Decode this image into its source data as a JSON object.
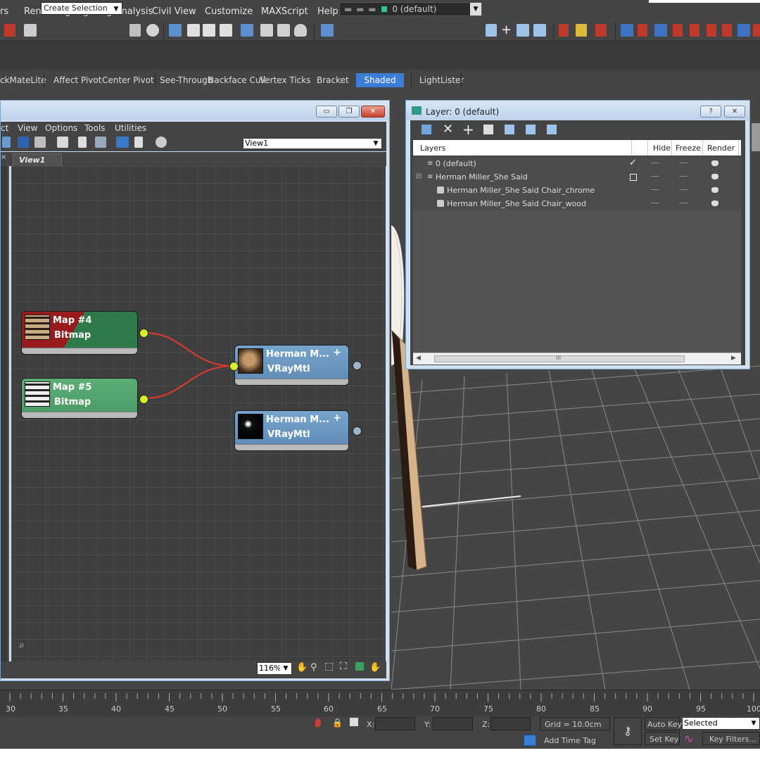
{
  "menu": {
    "items": [
      "rs",
      "Rendering",
      "Lighting Analysis",
      "Civil View",
      "Customize",
      "MAXScript",
      "Help"
    ]
  },
  "toolbar": {
    "selection_set_placeholder": "Create Selection Se",
    "layer_combo": "0 (default)"
  },
  "ribbon": {
    "items": [
      "ckMateLite",
      "Affect Pivot",
      "Center Pivot",
      "See-Through",
      "Backface Cull",
      "Vertex Ticks",
      "Bracket"
    ],
    "shaded": "Shaded",
    "lightlister": "LightLister"
  },
  "slate": {
    "window_buttons": [
      "▭",
      "❐",
      "✕"
    ],
    "menu": [
      "ct",
      "View",
      "Options",
      "Tools",
      "Utilities"
    ],
    "view_combo": "View1",
    "tab": "View1",
    "zoom": "116%",
    "nodes": [
      {
        "title": "Map #4",
        "subtitle": "Bitmap"
      },
      {
        "title": "Map #5",
        "subtitle": "Bitmap"
      },
      {
        "title": "Herman  M...",
        "subtitle": "VRayMtl"
      },
      {
        "title": "Herman  M...",
        "subtitle": "VRayMtl"
      }
    ],
    "plus": "+"
  },
  "layer_dialog": {
    "title": "Layer: 0 (default)",
    "help_button": "?",
    "close_button": "✕",
    "columns": {
      "layers": "Layers",
      "hide": "Hide",
      "freeze": "Freeze",
      "render": "Render"
    },
    "rows": [
      {
        "name": "0 (default)",
        "check": "✓"
      },
      {
        "name": "Herman Miller_She Said",
        "check": ""
      },
      {
        "name": "Herman Miller_She Said Chair_chrome",
        "check": ""
      },
      {
        "name": "Herman Miller_She Said Chair_wood",
        "check": ""
      }
    ],
    "scroll_thumb": "III"
  },
  "timeline": {
    "ticks": [
      "30",
      "35",
      "40",
      "45",
      "50",
      "55",
      "60",
      "65",
      "70",
      "75",
      "80",
      "85",
      "90",
      "95",
      "100"
    ]
  },
  "status": {
    "x_label": "X:",
    "y_label": "Y:",
    "z_label": "Z:",
    "grid": "Grid = 10.0cm",
    "auto_key": "Auto Key",
    "selected": "Selected",
    "set_key": "Set Key",
    "key_filters": "Key Filters...",
    "add_time_tag": "Add Time Tag"
  },
  "colors": {
    "accent": "#3b7ed8",
    "node_bitmap_dark": "#2f7a4a",
    "node_bitmap_light": "#5aad76",
    "node_red": "#9a1b1b",
    "node_vray": "#6590b8",
    "wire": "#e23a2a",
    "socket_out": "#d9ef2a"
  }
}
